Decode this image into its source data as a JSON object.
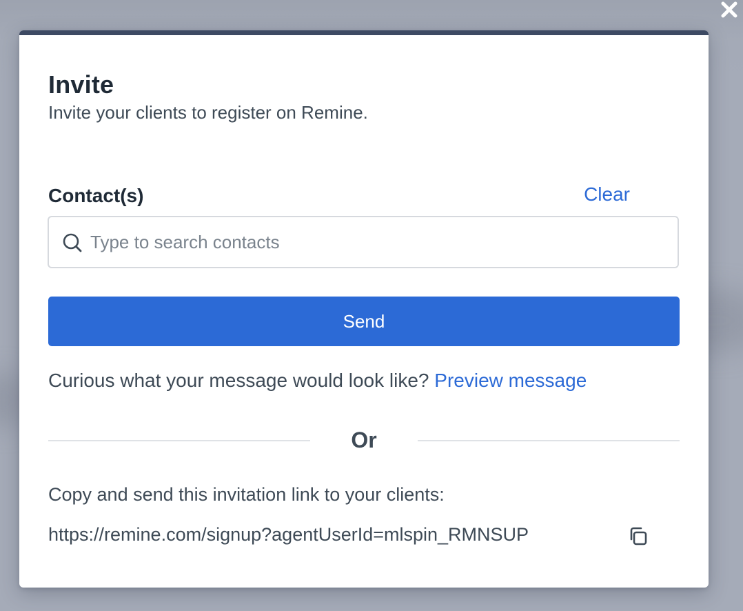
{
  "modal": {
    "title": "Invite",
    "subtitle": "Invite your clients to register on Remine."
  },
  "contacts": {
    "label": "Contact(s)",
    "clear_label": "Clear",
    "search_placeholder": "Type to search contacts",
    "search_value": ""
  },
  "send_button_label": "Send",
  "preview": {
    "prompt": "Curious what your message would look like?",
    "link_label": "Preview message"
  },
  "divider_label": "Or",
  "invite_link": {
    "instructions": "Copy and send this invitation link to your clients:",
    "url": "https://remine.com/signup?agentUserId=mlspin_RMNSUP"
  },
  "icons": {
    "close": "close-icon",
    "search": "search-icon",
    "copy": "copy-icon"
  },
  "colors": {
    "accent": "#2c6ad6",
    "topbar": "#3d4a63",
    "text": "#3e4a56",
    "heading": "#1f2a36",
    "backdrop": "#a5abb8"
  }
}
